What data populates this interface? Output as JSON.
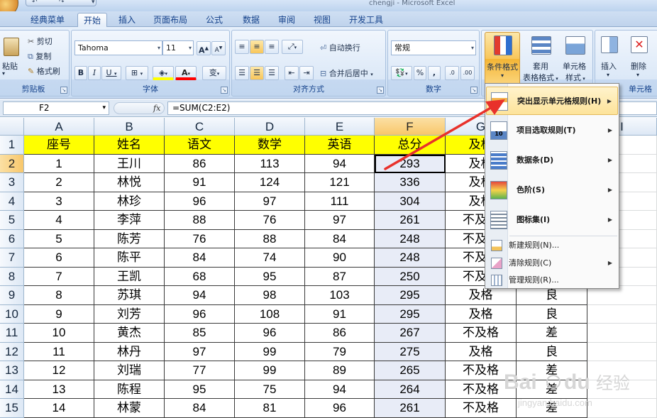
{
  "window": {
    "title": "chengji - Microsoft Excel"
  },
  "qat": {
    "undo": "↶",
    "redo": "↷",
    "customize": "▾"
  },
  "tabs": [
    {
      "label": "经典菜单"
    },
    {
      "label": "开始"
    },
    {
      "label": "插入"
    },
    {
      "label": "页面布局"
    },
    {
      "label": "公式"
    },
    {
      "label": "数据"
    },
    {
      "label": "审阅"
    },
    {
      "label": "视图"
    },
    {
      "label": "开发工具"
    }
  ],
  "ribbon": {
    "clipboard": {
      "paste": "粘贴",
      "cut": "剪切",
      "copy": "复制",
      "format_painter": "格式刷",
      "label": "剪贴板"
    },
    "font": {
      "name": "Tahoma",
      "size": "11",
      "grow": "A",
      "shrink": "A",
      "bold": "B",
      "italic": "I",
      "underline": "U",
      "label": "字体",
      "wen": "变"
    },
    "alignment": {
      "wrap": "自动换行",
      "merge": "合并后居中",
      "label": "对齐方式"
    },
    "number": {
      "format": "常规",
      "percent": "%",
      "comma": ",",
      "label": "数字"
    },
    "styles": {
      "conditional": "条件格式",
      "table_line1": "套用",
      "table_line2": "表格格式",
      "cell_line1": "单元格",
      "cell_line2": "样式"
    },
    "cells": {
      "insert": "插入",
      "delete": "删除",
      "label": "单元格"
    }
  },
  "formula_bar": {
    "name_box": "F2",
    "fx": "fx",
    "formula": "=SUM(C2:E2)"
  },
  "columns": [
    "A",
    "B",
    "C",
    "D",
    "E",
    "F",
    "G",
    "H",
    "I"
  ],
  "headers": [
    "座号",
    "姓名",
    "语文",
    "数学",
    "英语",
    "总分",
    "及格"
  ],
  "rows": [
    {
      "n": "2",
      "cells": [
        "1",
        "王川",
        "86",
        "113",
        "94",
        "293",
        "及格",
        ""
      ]
    },
    {
      "n": "3",
      "cells": [
        "2",
        "林悦",
        "91",
        "124",
        "121",
        "336",
        "及格",
        ""
      ]
    },
    {
      "n": "4",
      "cells": [
        "3",
        "林珍",
        "96",
        "97",
        "111",
        "304",
        "及格",
        ""
      ]
    },
    {
      "n": "5",
      "cells": [
        "4",
        "李萍",
        "88",
        "76",
        "97",
        "261",
        "不及格",
        ""
      ]
    },
    {
      "n": "6",
      "cells": [
        "5",
        "陈芳",
        "76",
        "88",
        "84",
        "248",
        "不及格",
        ""
      ]
    },
    {
      "n": "7",
      "cells": [
        "6",
        "陈平",
        "84",
        "74",
        "90",
        "248",
        "不及格",
        ""
      ]
    },
    {
      "n": "8",
      "cells": [
        "7",
        "王凯",
        "68",
        "95",
        "87",
        "250",
        "不及格",
        ""
      ]
    },
    {
      "n": "9",
      "cells": [
        "8",
        "苏琪",
        "94",
        "98",
        "103",
        "295",
        "及格",
        "良"
      ]
    },
    {
      "n": "10",
      "cells": [
        "9",
        "刘芳",
        "96",
        "108",
        "91",
        "295",
        "及格",
        "良"
      ]
    },
    {
      "n": "11",
      "cells": [
        "10",
        "黄杰",
        "85",
        "96",
        "86",
        "267",
        "不及格",
        "差"
      ]
    },
    {
      "n": "12",
      "cells": [
        "11",
        "林丹",
        "97",
        "99",
        "79",
        "275",
        "及格",
        "良"
      ]
    },
    {
      "n": "13",
      "cells": [
        "12",
        "刘瑞",
        "77",
        "99",
        "89",
        "265",
        "不及格",
        "差"
      ]
    },
    {
      "n": "14",
      "cells": [
        "13",
        "陈程",
        "95",
        "75",
        "94",
        "264",
        "不及格",
        "差"
      ]
    },
    {
      "n": "15",
      "cells": [
        "14",
        "林蒙",
        "84",
        "81",
        "96",
        "261",
        "不及格",
        "差"
      ]
    }
  ],
  "menu": {
    "items": [
      {
        "label": "突出显示单元格规则(H)"
      },
      {
        "label": "项目选取规则(T)"
      },
      {
        "label": "数据条(D)"
      },
      {
        "label": "色阶(S)"
      },
      {
        "label": "图标集(I)"
      }
    ],
    "small_items": [
      {
        "label": "新建规则(N)..."
      },
      {
        "label": "清除规则(C)"
      },
      {
        "label": "管理规则(R)..."
      }
    ]
  },
  "colors": {
    "header_fill": "#ffff00",
    "arrow": "#e8312b",
    "selected_header": "#f8c76b"
  }
}
